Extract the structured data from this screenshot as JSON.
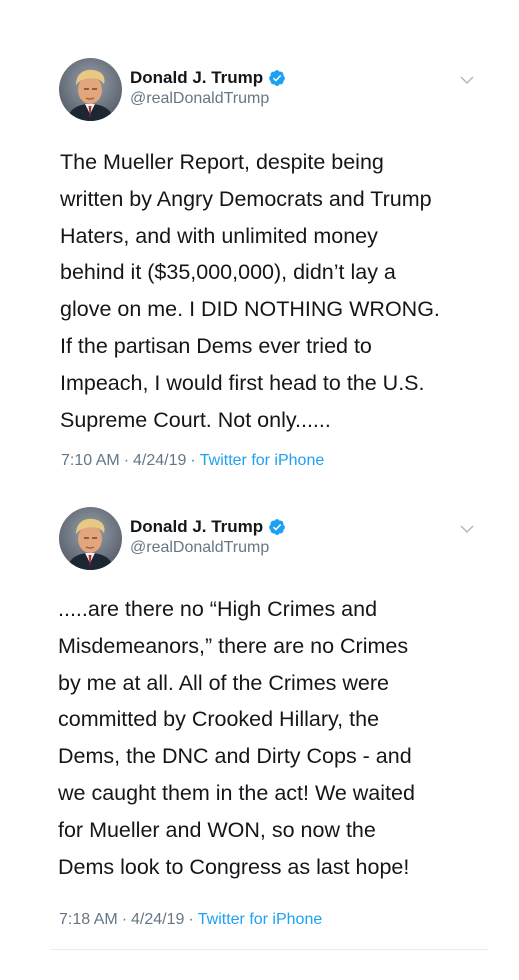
{
  "colors": {
    "verified": "#1da1f2",
    "link": "#1da1f2",
    "secondary_text": "#657786",
    "primary_text": "#14171a"
  },
  "tweets": [
    {
      "display_name": "Donald J. Trump",
      "handle": "@realDonaldTrump",
      "verified_icon": "verified-badge-icon",
      "menu_icon": "chevron-down-icon",
      "lines": [
        "The Mueller Report, despite being",
        "written by Angry Democrats and Trump",
        "Haters, and with unlimited money",
        "behind it ($35,000,000), didn’t lay a",
        "glove on me. I DID NOTHING WRONG.",
        "If the partisan Dems ever tried to",
        "Impeach, I would first head to the U.S.",
        "Supreme Court. Not only......"
      ],
      "time": "7:10 AM",
      "date": "4/24/19",
      "source": "Twitter for iPhone"
    },
    {
      "display_name": "Donald J. Trump",
      "handle": "@realDonaldTrump",
      "verified_icon": "verified-badge-icon",
      "menu_icon": "chevron-down-icon",
      "lines": [
        ".....are there no “High Crimes and",
        "Misdemeanors,” there are no Crimes",
        "by me at all. All of the Crimes were",
        "committed by Crooked Hillary, the",
        "Dems, the DNC and Dirty Cops - and",
        "we caught them in the act! We waited",
        "for Mueller and WON, so now the",
        "Dems look to Congress as last hope!"
      ],
      "time": "7:18 AM",
      "date": "4/24/19",
      "source": "Twitter for iPhone"
    }
  ],
  "separator": "·"
}
